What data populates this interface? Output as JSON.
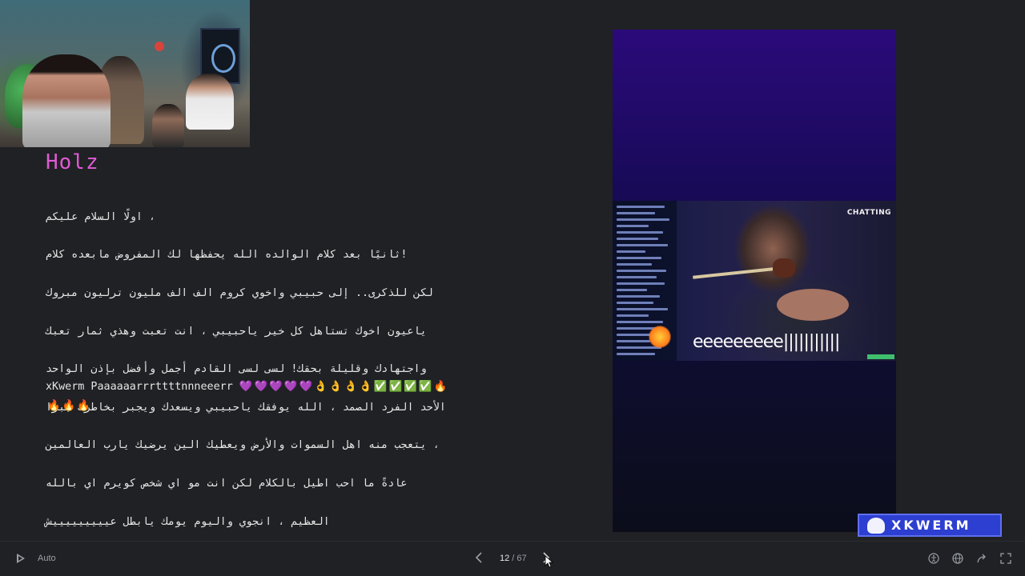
{
  "webcam": {
    "label": "webcam-feed"
  },
  "message": {
    "author": "Holz",
    "lines": [
      "، اولًا السلام عليكم",
      "!ثانيًا بعد كلام الوالده الله يحفظها لك المفروض مابعده كلام",
      "لكن للذكرى.. إلى حبيبي واخوي كروم الف الف مليون ترليون مبروك",
      "ياعيون اخوك تستاهل كل خير ياحبيبي ، انت تعبت وهذي ثمار تعبك",
      "واجتهادك وقليلة بحقك! لسى لسى القادم أجمل وأفضل بإذن الواحد",
      "الأحد الفرد الصمد ، الله يوفقك ياحبيبي ويسعدك ويجبر بخاطرك جبرًا",
      "، يتعجب منه اهل السموات والأرض ويعطيك الين يرضيك يارب العالمين",
      "عادةً ما احب اطيل بالكلام لكن انت مو اي شخص كويرم اي بالله",
      "العظيم ، انجوي واليوم يومك يابطل عيييييييييش"
    ],
    "shout_text": "xKwerm Paaaaaarrrttttnnneeerr",
    "emojis_line1": "💜💜💜💜💜👌👌👌👌✅✅✅✅🔥",
    "emojis_line2": "🔥🔥🔥"
  },
  "video": {
    "overlay_label": "CHATTING",
    "caption": "eeeeeeeee|||||||||||"
  },
  "brand": {
    "name": "XKWERM"
  },
  "controls": {
    "auto_label": "Auto",
    "current_page": "12",
    "page_separator": " / ",
    "total_pages": "67"
  }
}
